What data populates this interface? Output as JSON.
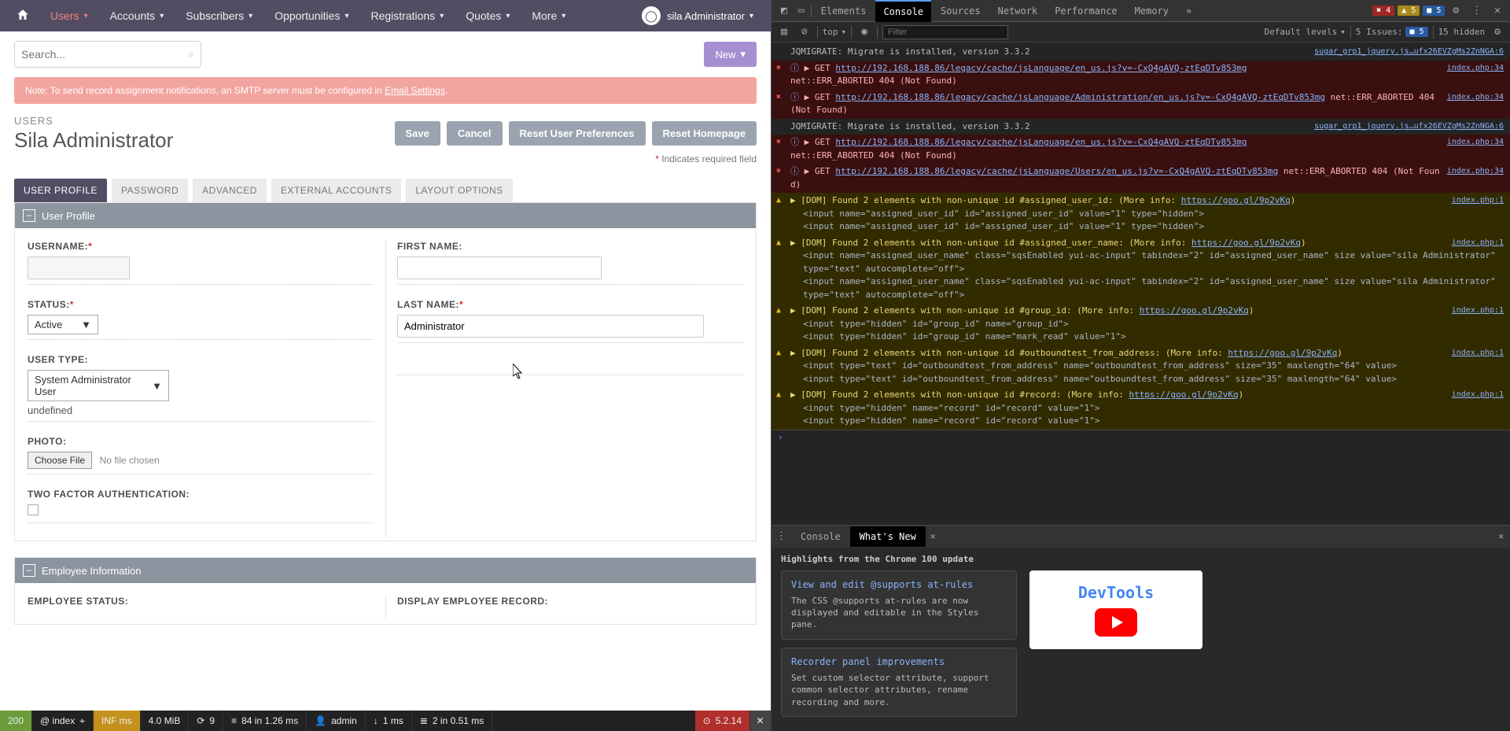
{
  "topbar": {
    "items": [
      "Users",
      "Accounts",
      "Subscribers",
      "Opportunities",
      "Registrations",
      "Quotes",
      "More"
    ],
    "user": "sila Administrator"
  },
  "search": {
    "placeholder": "Search..."
  },
  "new_button": "New",
  "alert": {
    "text": "Note: To send record assignment notifications, an SMTP server must be configured in ",
    "link": "Email Settings"
  },
  "breadcrumb": "USERS",
  "page_title": "Sila Administrator",
  "buttons": {
    "save": "Save",
    "cancel": "Cancel",
    "reset_prefs": "Reset User Preferences",
    "reset_home": "Reset Homepage"
  },
  "required_note": "Indicates required field",
  "tabs": [
    "USER PROFILE",
    "PASSWORD",
    "ADVANCED",
    "EXTERNAL ACCOUNTS",
    "LAYOUT OPTIONS"
  ],
  "panel1_title": "User Profile",
  "panel2_title": "Employee Information",
  "fields": {
    "username_label": "USERNAME:",
    "firstname_label": "FIRST NAME:",
    "status_label": "STATUS:",
    "lastname_label": "LAST NAME:",
    "usertype_label": "USER TYPE:",
    "photo_label": "PHOTO:",
    "twofa_label": "TWO FACTOR AUTHENTICATION:",
    "empstatus_label": "EMPLOYEE STATUS:",
    "disprec_label": "DISPLAY EMPLOYEE RECORD:",
    "username_value": "",
    "firstname_value": "",
    "lastname_value": "Administrator",
    "status_value": "Active",
    "usertype_value": "System Administrator User",
    "undefined_text": "undefined",
    "choose_file": "Choose File",
    "no_file": "No file chosen"
  },
  "debugbar": {
    "code": "200",
    "route": "@ index",
    "inf": "INF ms",
    "mem": "4.0 MiB",
    "ajax": "9",
    "db": "84 in 1.26 ms",
    "user": "admin",
    "time": "1 ms",
    "cache": "2 in 0.51 ms",
    "sf": "5.2.14"
  },
  "devtools": {
    "tabs": [
      "Elements",
      "Console",
      "Sources",
      "Network",
      "Performance",
      "Memory"
    ],
    "err_count": "4",
    "warn_count": "5",
    "msg_count": "5",
    "top": "top",
    "filter_placeholder": "Filter",
    "default_levels": "Default levels",
    "issues_label": "5 Issues:",
    "issues_count": "5",
    "hidden_count": "15 hidden",
    "jq_msg": "JQMIGRATE: Migrate is installed, version 3.3.2",
    "jq_src": "sugar_grp1_jquery.js…ufx26EVZgMs2ZnNGA:6",
    "abort": "net::ERR_ABORTED 404 (Not Found)",
    "get": "GET",
    "url1": "http://192.168.188.86/legacy/cache/jsLanguage/en_us.js?v=-CxQ4gAVQ-ztEqDTv853mg",
    "url2": "http://192.168.188.86/legacy/cache/jsLanguage/Administration/en_us.js?v=-CxQ4gAVQ-ztEqDTv853mg",
    "url3": "http://192.168.188.86/legacy/cache/jsLanguage/en_us.js?v=-CxQ4gAVQ-ztEqDTv853mg",
    "url4": "http://192.168.188.86/legacy/cache/jsLanguage/Users/en_us.js?v=-CxQ4gAVQ-ztEqDTv853mg",
    "srcidx": "index.php:34",
    "srcidx1": "index.php:1",
    "dom_pre": "[DOM] Found 2 elements with non-unique id ",
    "more": " (More info: ",
    "goog": "https://goo.gl/9p2vKq",
    "cl": ")",
    "id1": "#assigned_user_id:",
    "id2": "#assigned_user_name:",
    "id3": "#group_id:",
    "id4": "#outboundtest_from_address:",
    "id5": "#record:",
    "in1": "<input name=\"assigned_user_id\" id=\"assigned_user_id\" value=\"1\" type=\"hidden\">",
    "in1b": "<input name=\"assigned_user_id\" id=\"assigned_user_id\" value=\"1\" type=\"hidden\">",
    "in2": "<input name=\"assigned_user_name\" class=\"sqsEnabled yui-ac-input\" tabindex=\"2\" id=\"assigned_user_name\" size value=\"sila Administrator\" type=\"text\" autocomplete=\"off\">",
    "in2b": "<input name=\"assigned_user_name\" class=\"sqsEnabled yui-ac-input\" tabindex=\"2\" id=\"assigned_user_name\" size value=\"sila Administrator\" type=\"text\" autocomplete=\"off\">",
    "in3": "<input type=\"hidden\" id=\"group_id\" name=\"group_id\">",
    "in3b": "<input type=\"hidden\" id=\"group_id\" name=\"mark_read\" value=\"1\">",
    "in4": "<input type=\"text\" id=\"outboundtest_from_address\" name=\"outboundtest_from_address\" size=\"35\" maxlength=\"64\" value>",
    "in4b": "<input type=\"text\" id=\"outboundtest_from_address\" name=\"outboundtest_from_address\" size=\"35\" maxlength=\"64\" value>",
    "in5": "<input type=\"hidden\" name=\"record\" id=\"record\" value=\"1\">",
    "in5b": "<input type=\"hidden\" name=\"record\" id=\"record\" value=\"1\">"
  },
  "drawer": {
    "tab1": "Console",
    "tab2": "What's New",
    "headline": "Highlights from the Chrome 100 update",
    "card1_title": "View and edit @supports at-rules",
    "card1_text": "The CSS @supports at-rules are now displayed and editable in the Styles pane.",
    "card2_title": "Recorder panel improvements",
    "card2_text": "Set custom selector attribute, support common selector attributes, rename recording and more.",
    "logo": "DevTools"
  }
}
